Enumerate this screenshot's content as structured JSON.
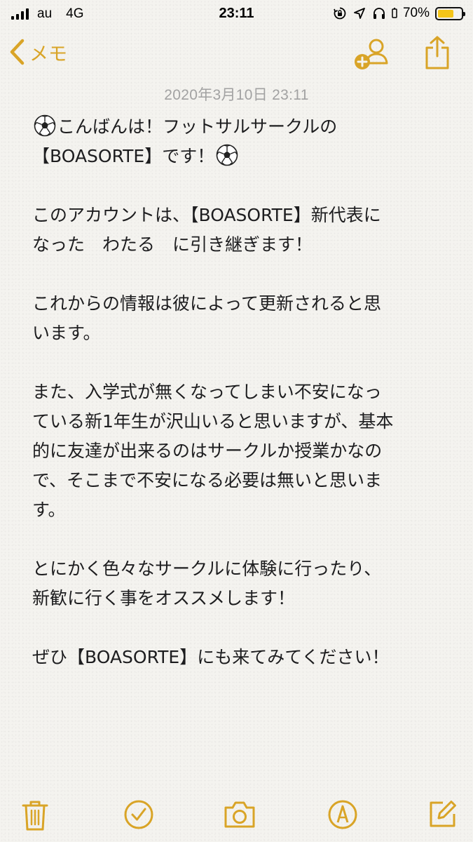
{
  "status_bar": {
    "carrier": "au",
    "network": "4G",
    "time": "23:11",
    "battery_percent": "70%",
    "battery_level": 0.7,
    "battery_color": "#f5c518"
  },
  "nav": {
    "back_label": "メモ",
    "accent_color": "#d9a427",
    "icons": [
      "chevron-left-icon",
      "add-person-icon",
      "share-icon"
    ]
  },
  "note": {
    "date": "2020年3月10日 23:11",
    "paragraphs": [
      "⚽こんばんは！フットサルサークルの\n【BOASORTE】です！⚽",
      "このアカウントは、【BOASORTE】新代表に\nなった　わたる　に引き継ぎます！",
      "これからの情報は彼によって更新されると思\nいます。",
      "また、入学式が無くなってしまい不安になっ\nている新1年生が沢山いると思いますが、基本\n的に友達が出来るのはサークルか授業かなの\nで、そこまで不安になる必要は無いと思いま\nす。",
      "とにかく色々なサークルに体験に行ったり、\n新歓に行く事をオススメします！",
      "ぜひ【BOASORTE】にも来てみてください！"
    ]
  },
  "toolbar": {
    "icons": [
      "trash-icon",
      "checklist-icon",
      "camera-icon",
      "markup-icon",
      "compose-icon"
    ]
  }
}
